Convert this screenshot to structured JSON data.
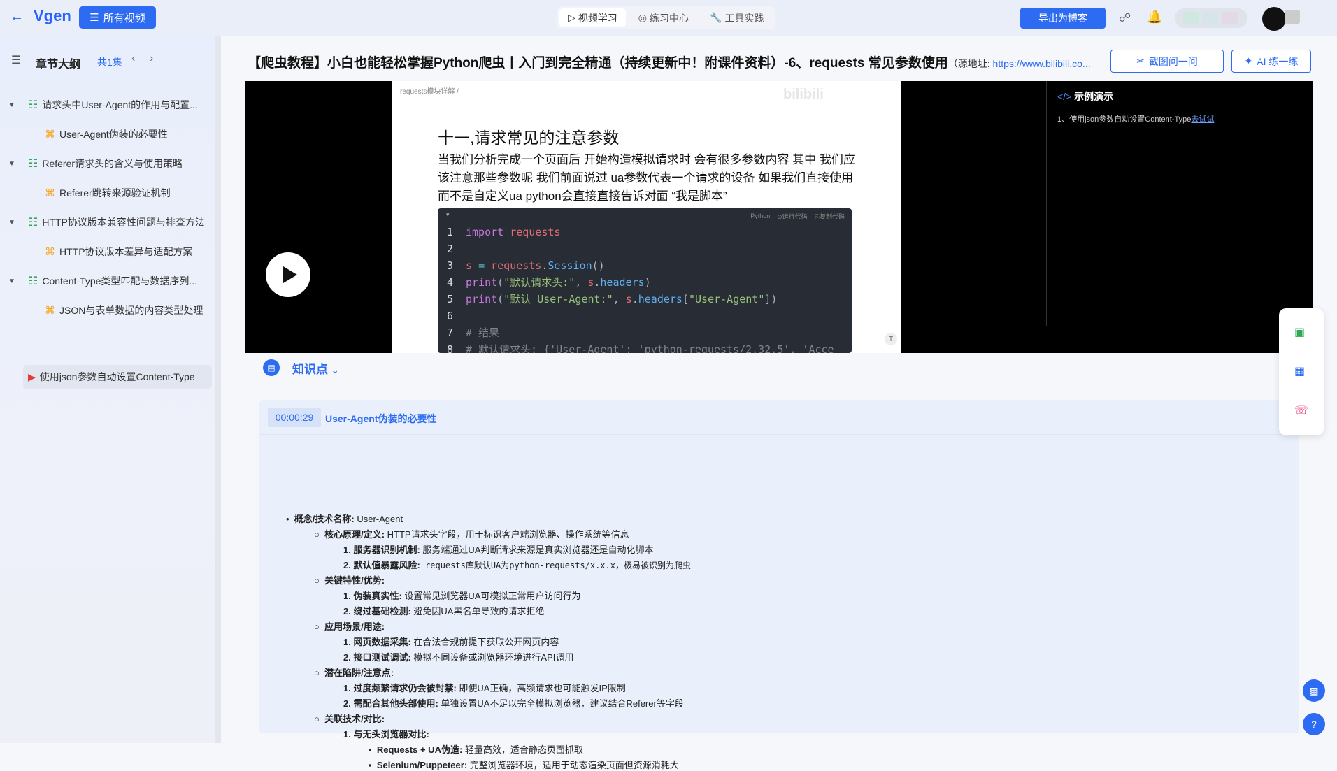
{
  "header": {
    "logo": "Vgen",
    "all_videos": "所有视频",
    "tabs": [
      {
        "icon": "play-icon",
        "label": "视频学习",
        "active": true
      },
      {
        "icon": "target-icon",
        "label": "练习中心",
        "active": false
      },
      {
        "icon": "wrench-icon",
        "label": "工具实践",
        "active": false
      }
    ],
    "export_label": "导出为博客"
  },
  "sidebar": {
    "title": "章节大纲",
    "count": "共1集",
    "items": [
      {
        "level": 1,
        "label": "请求头中User-Agent的作用与配置..."
      },
      {
        "level": 2,
        "label": "User-Agent伪装的必要性"
      },
      {
        "level": 1,
        "label": "Referer请求头的含义与使用策略"
      },
      {
        "level": 2,
        "label": "Referer跳转来源验证机制"
      },
      {
        "level": 1,
        "label": "HTTP协议版本兼容性问题与排查方法"
      },
      {
        "level": 2,
        "label": "HTTP协议版本差异与适配方案"
      },
      {
        "level": 1,
        "label": "Content-Type类型匹配与数据序列..."
      },
      {
        "level": 2,
        "label": "JSON与表单数据的内容类型处理"
      },
      {
        "level": 3,
        "label": "使用json参数自动设置Content-Type"
      }
    ]
  },
  "content": {
    "title": "【爬虫教程】小白也能轻松掌握Python爬虫丨入门到完全精通（持续更新中！附课件资料）-6、requests 常见参数使用",
    "source_prefix": "（源地址: ",
    "source_url": "https://www.bilibili.co...",
    "cut_ask": "截图问一问",
    "ai_practice": "AI 练一练"
  },
  "video": {
    "crumb": "requests模块详解 /",
    "watermark": "bilibili",
    "slide_heading": "十一,请求常见的注意参数",
    "slide_text": "当我们分析完成一个页面后 开始构造模拟请求时 会有很多参数内容 其中 我们应该注意那些参数呢 我们前面说过 ua参数代表一个请求的设备 如果我们直接使用而不是自定义ua python会直接直接告诉对面 “我是脚本”",
    "code_lang": "Python",
    "code_run": "⊙运行代码",
    "code_copy": "⎘复制代码",
    "demo_heading": "示例演示",
    "demo_item": "1、使用json参数自动设置Content-Type",
    "demo_link": "去试试"
  },
  "knowledge": {
    "title": "知识点",
    "timestamp": "00:00:29",
    "section": "User-Agent伪装的必要性",
    "lines": [
      {
        "bold": "概念/技术名称:",
        "text": " User-Agent"
      },
      {
        "bold": "核心原理/定义:",
        "text": " HTTP请求头字段，用于标识客户端浏览器、操作系统等信息"
      },
      {
        "bold": "1. 服务器识别机制:",
        "text": " 服务端通过UA判断请求来源是真实浏览器还是自动化脚本"
      },
      {
        "bold": "2. 默认值暴露风险:",
        "text": " requests库默认UA为python-requests/x.x.x，极易被识别为爬虫"
      },
      {
        "bold": "关键特性/优势:",
        "text": ""
      },
      {
        "bold": "1. 伪装真实性:",
        "text": " 设置常见浏览器UA可模拟正常用户访问行为"
      },
      {
        "bold": "2. 绕过基础检测:",
        "text": " 避免因UA黑名单导致的请求拒绝"
      },
      {
        "bold": "应用场景/用途:",
        "text": ""
      },
      {
        "bold": "1. 网页数据采集:",
        "text": " 在合法合规前提下获取公开网页内容"
      },
      {
        "bold": "2. 接口测试调试:",
        "text": " 模拟不同设备或浏览器环境进行API调用"
      },
      {
        "bold": "潜在陷阱/注意点:",
        "text": ""
      },
      {
        "bold": "1. 过度频繁请求仍会被封禁:",
        "text": " 即使UA正确，高频请求也可能触发IP限制"
      },
      {
        "bold": "2. 需配合其他头部使用:",
        "text": " 单独设置UA不足以完全模拟浏览器，建议结合Referer等字段"
      },
      {
        "bold": "关联技术/对比:",
        "text": ""
      },
      {
        "bold": "1. 与无头浏览器对比:",
        "text": ""
      },
      {
        "bold": "Requests + UA伪造:",
        "text": " 轻量高效，适合静态页面抓取"
      },
      {
        "bold": "Selenium/Puppeteer:",
        "text": " 完整浏览器环境，适用于动态渲染页面但资源消耗大"
      }
    ]
  }
}
